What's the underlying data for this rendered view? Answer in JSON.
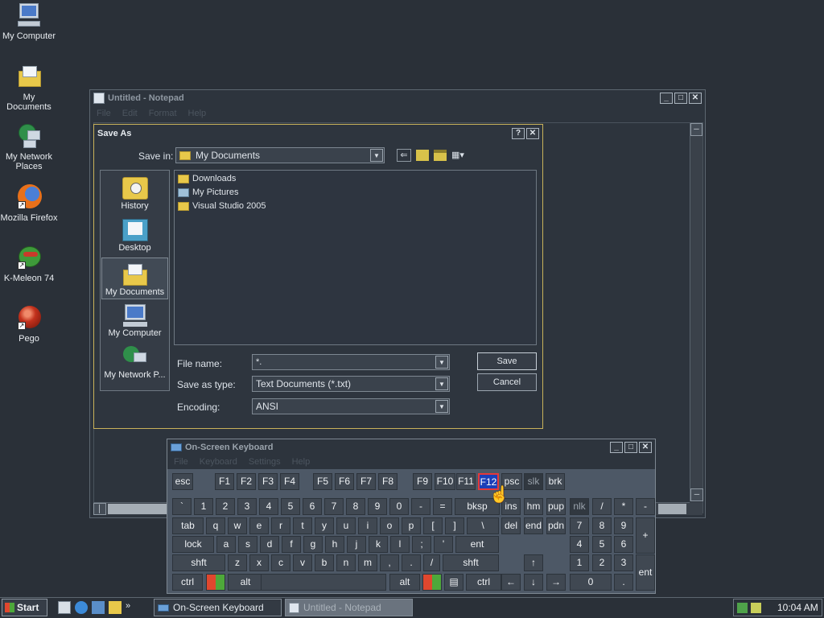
{
  "desktop": {
    "icons": [
      {
        "label": "My Computer"
      },
      {
        "label": "My Documents"
      },
      {
        "label": "My Network Places"
      },
      {
        "label": "Mozilla Firefox"
      },
      {
        "label": "K-Meleon 74"
      },
      {
        "label": "Pego"
      }
    ]
  },
  "notepad": {
    "title": "Untitled - Notepad",
    "menu": [
      "File",
      "Edit",
      "Format",
      "Help"
    ]
  },
  "save_as": {
    "title": "Save As",
    "help_btn": "?",
    "close_btn": "✕",
    "save_in_label": "Save in:",
    "save_in_value": "My Documents",
    "places": [
      "History",
      "Desktop",
      "My Documents",
      "My Computer",
      "My Network P..."
    ],
    "files": [
      "Downloads",
      "My Pictures",
      "Visual Studio 2005"
    ],
    "file_name_label": "File name:",
    "file_name_value": "*.",
    "save_type_label": "Save as type:",
    "save_type_value": "Text Documents (*.txt)",
    "encoding_label": "Encoding:",
    "encoding_value": "ANSI",
    "save_button": "Save",
    "cancel_button": "Cancel"
  },
  "osk": {
    "title": "On-Screen Keyboard",
    "menu": [
      "File",
      "Keyboard",
      "Settings",
      "Help"
    ],
    "row_f": [
      "esc",
      "F1",
      "F2",
      "F3",
      "F4",
      "F5",
      "F6",
      "F7",
      "F8",
      "F9",
      "F10",
      "F11",
      "F12",
      "psc",
      "slk",
      "brk"
    ],
    "row1": [
      "`",
      "1",
      "2",
      "3",
      "4",
      "5",
      "6",
      "7",
      "8",
      "9",
      "0",
      "-",
      "=",
      "bksp",
      "ins",
      "hm",
      "pup",
      "nlk",
      "/",
      "*",
      "-"
    ],
    "row2": [
      "tab",
      "q",
      "w",
      "e",
      "r",
      "t",
      "y",
      "u",
      "i",
      "o",
      "p",
      "[",
      "]",
      "\\",
      "del",
      "end",
      "pdn",
      "7",
      "8",
      "9",
      "+"
    ],
    "row3": [
      "lock",
      "a",
      "s",
      "d",
      "f",
      "g",
      "h",
      "j",
      "k",
      "l",
      ";",
      "'",
      "ent",
      "4",
      "5",
      "6"
    ],
    "row4": [
      "shft",
      "z",
      "x",
      "c",
      "v",
      "b",
      "n",
      "m",
      ",",
      ".",
      "/",
      "shft",
      "↑",
      "1",
      "2",
      "3",
      "ent"
    ],
    "row5": [
      "ctrl",
      "alt",
      "alt",
      "ctrl",
      "←",
      "↓",
      "→",
      "0",
      "."
    ],
    "selected_key": "F12"
  },
  "taskbar": {
    "start": "Start",
    "items": [
      "On-Screen Keyboard",
      "Untitled - Notepad"
    ],
    "clock": "10:04 AM"
  },
  "colors": {
    "desktop": "#2a3038",
    "selection": "#1b3fb8",
    "accent_border": "#c9b25a"
  }
}
